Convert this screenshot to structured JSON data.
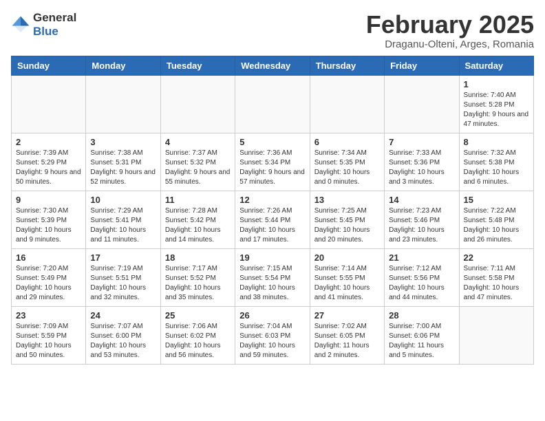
{
  "header": {
    "logo_general": "General",
    "logo_blue": "Blue",
    "month_title": "February 2025",
    "location": "Draganu-Olteni, Arges, Romania"
  },
  "weekdays": [
    "Sunday",
    "Monday",
    "Tuesday",
    "Wednesday",
    "Thursday",
    "Friday",
    "Saturday"
  ],
  "weeks": [
    [
      {
        "day": "",
        "detail": ""
      },
      {
        "day": "",
        "detail": ""
      },
      {
        "day": "",
        "detail": ""
      },
      {
        "day": "",
        "detail": ""
      },
      {
        "day": "",
        "detail": ""
      },
      {
        "day": "",
        "detail": ""
      },
      {
        "day": "1",
        "detail": "Sunrise: 7:40 AM\nSunset: 5:28 PM\nDaylight: 9 hours and 47 minutes."
      }
    ],
    [
      {
        "day": "2",
        "detail": "Sunrise: 7:39 AM\nSunset: 5:29 PM\nDaylight: 9 hours and 50 minutes."
      },
      {
        "day": "3",
        "detail": "Sunrise: 7:38 AM\nSunset: 5:31 PM\nDaylight: 9 hours and 52 minutes."
      },
      {
        "day": "4",
        "detail": "Sunrise: 7:37 AM\nSunset: 5:32 PM\nDaylight: 9 hours and 55 minutes."
      },
      {
        "day": "5",
        "detail": "Sunrise: 7:36 AM\nSunset: 5:34 PM\nDaylight: 9 hours and 57 minutes."
      },
      {
        "day": "6",
        "detail": "Sunrise: 7:34 AM\nSunset: 5:35 PM\nDaylight: 10 hours and 0 minutes."
      },
      {
        "day": "7",
        "detail": "Sunrise: 7:33 AM\nSunset: 5:36 PM\nDaylight: 10 hours and 3 minutes."
      },
      {
        "day": "8",
        "detail": "Sunrise: 7:32 AM\nSunset: 5:38 PM\nDaylight: 10 hours and 6 minutes."
      }
    ],
    [
      {
        "day": "9",
        "detail": "Sunrise: 7:30 AM\nSunset: 5:39 PM\nDaylight: 10 hours and 9 minutes."
      },
      {
        "day": "10",
        "detail": "Sunrise: 7:29 AM\nSunset: 5:41 PM\nDaylight: 10 hours and 11 minutes."
      },
      {
        "day": "11",
        "detail": "Sunrise: 7:28 AM\nSunset: 5:42 PM\nDaylight: 10 hours and 14 minutes."
      },
      {
        "day": "12",
        "detail": "Sunrise: 7:26 AM\nSunset: 5:44 PM\nDaylight: 10 hours and 17 minutes."
      },
      {
        "day": "13",
        "detail": "Sunrise: 7:25 AM\nSunset: 5:45 PM\nDaylight: 10 hours and 20 minutes."
      },
      {
        "day": "14",
        "detail": "Sunrise: 7:23 AM\nSunset: 5:46 PM\nDaylight: 10 hours and 23 minutes."
      },
      {
        "day": "15",
        "detail": "Sunrise: 7:22 AM\nSunset: 5:48 PM\nDaylight: 10 hours and 26 minutes."
      }
    ],
    [
      {
        "day": "16",
        "detail": "Sunrise: 7:20 AM\nSunset: 5:49 PM\nDaylight: 10 hours and 29 minutes."
      },
      {
        "day": "17",
        "detail": "Sunrise: 7:19 AM\nSunset: 5:51 PM\nDaylight: 10 hours and 32 minutes."
      },
      {
        "day": "18",
        "detail": "Sunrise: 7:17 AM\nSunset: 5:52 PM\nDaylight: 10 hours and 35 minutes."
      },
      {
        "day": "19",
        "detail": "Sunrise: 7:15 AM\nSunset: 5:54 PM\nDaylight: 10 hours and 38 minutes."
      },
      {
        "day": "20",
        "detail": "Sunrise: 7:14 AM\nSunset: 5:55 PM\nDaylight: 10 hours and 41 minutes."
      },
      {
        "day": "21",
        "detail": "Sunrise: 7:12 AM\nSunset: 5:56 PM\nDaylight: 10 hours and 44 minutes."
      },
      {
        "day": "22",
        "detail": "Sunrise: 7:11 AM\nSunset: 5:58 PM\nDaylight: 10 hours and 47 minutes."
      }
    ],
    [
      {
        "day": "23",
        "detail": "Sunrise: 7:09 AM\nSunset: 5:59 PM\nDaylight: 10 hours and 50 minutes."
      },
      {
        "day": "24",
        "detail": "Sunrise: 7:07 AM\nSunset: 6:00 PM\nDaylight: 10 hours and 53 minutes."
      },
      {
        "day": "25",
        "detail": "Sunrise: 7:06 AM\nSunset: 6:02 PM\nDaylight: 10 hours and 56 minutes."
      },
      {
        "day": "26",
        "detail": "Sunrise: 7:04 AM\nSunset: 6:03 PM\nDaylight: 10 hours and 59 minutes."
      },
      {
        "day": "27",
        "detail": "Sunrise: 7:02 AM\nSunset: 6:05 PM\nDaylight: 11 hours and 2 minutes."
      },
      {
        "day": "28",
        "detail": "Sunrise: 7:00 AM\nSunset: 6:06 PM\nDaylight: 11 hours and 5 minutes."
      },
      {
        "day": "",
        "detail": ""
      }
    ]
  ]
}
